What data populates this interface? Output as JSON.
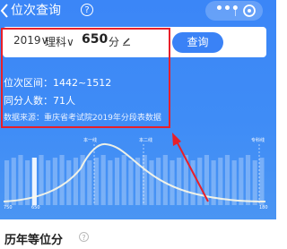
{
  "header": {
    "title": "位次查询",
    "help_icon": "question-circle-icon",
    "more_icon": "more-icon",
    "close_icon": "close-circle-icon"
  },
  "query": {
    "year": "2019",
    "subject": "理科",
    "score": "650",
    "score_unit": "分",
    "button_label": "查询"
  },
  "result": {
    "rank_range": "位次区间：1442~1512",
    "same_score_count": "同分人数：71人",
    "source": "数据来源：重庆省考试院2019年分段表数据"
  },
  "chart_data": {
    "type": "bar",
    "line_labels": [
      "本一线",
      "本二线",
      "专科线"
    ],
    "x_labels": [
      "750",
      "650",
      "180"
    ],
    "highlight_label": "650"
  },
  "section": {
    "title": "历年等位分",
    "info_icon": "info-circle-icon"
  },
  "colors": {
    "primary_blue": "#3b86f7",
    "annotation_red": "#e8202a"
  }
}
